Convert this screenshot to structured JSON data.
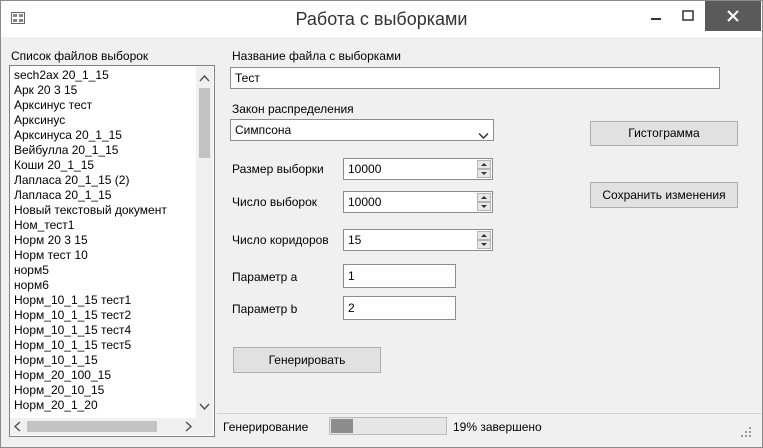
{
  "window": {
    "title": "Работа с выборками"
  },
  "file_list": {
    "label": "Список файлов выборок",
    "items": [
      "sech2ax 20_1_15",
      "Арк 20 3 15",
      "Арксинус тест",
      "Арксинус",
      "Арксинуса 20_1_15",
      "Вейбулла 20_1_15",
      "Коши 20_1_15",
      "Лапласа 20_1_15 (2)",
      "Лапласа 20_1_15",
      "Новый текстовый документ",
      "Ном_тест1",
      "Норм 20 3 15",
      "Норм тест 10",
      "норм5",
      "норм6",
      "Норм_10_1_15 тест1",
      "Норм_10_1_15 тест2",
      "Норм_10_1_15 тест4",
      "Норм_10_1_15 тест5",
      "Норм_10_1_15",
      "Норм_20_100_15",
      "Норм_20_10_15",
      "Норм_20_1_20"
    ]
  },
  "form": {
    "filename_label": "Название файла с выборками",
    "filename_value": "Тест",
    "law_label": "Закон распределения",
    "law_value": "Симпсона",
    "sample_size_label": "Размер выборки",
    "sample_size_value": "10000",
    "sample_count_label": "Число выборок",
    "sample_count_value": "10000",
    "corridors_label": "Число коридоров",
    "corridors_value": "15",
    "param_a_label": "Параметр а",
    "param_a_value": "1",
    "param_b_label": "Параметр b",
    "param_b_value": "2",
    "generate_label": "Генерировать",
    "histogram_label": "Гистограмма",
    "save_label": "Сохранить изменения"
  },
  "status": {
    "label": "Генерирование",
    "progress_percent": 19,
    "progress_text": "19% завершено"
  }
}
